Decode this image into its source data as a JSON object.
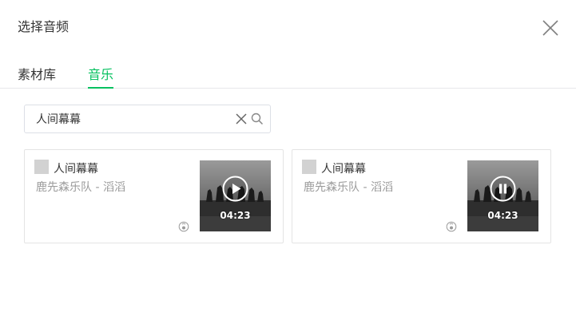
{
  "dialog": {
    "title": "选择音频",
    "close_icon": "close-icon"
  },
  "tabs": [
    {
      "label": "素材库",
      "active": false
    },
    {
      "label": "音乐",
      "active": true
    }
  ],
  "search": {
    "value": "人间幕幕",
    "placeholder": "",
    "clear_icon": "clear-icon",
    "search_icon": "search-icon"
  },
  "results": [
    {
      "title": "人间幕幕",
      "artist": "鹿先森乐队 - 滔滔",
      "duration": "04:23",
      "state": "paused",
      "control_icon": "play-icon"
    },
    {
      "title": "人间幕幕",
      "artist": "鹿先森乐队 - 滔滔",
      "duration": "04:23",
      "state": "playing",
      "control_icon": "pause-icon"
    }
  ],
  "colors": {
    "accent": "#07c160",
    "text": "#353535",
    "muted": "#9a9a9a",
    "border": "#e4e4e4"
  }
}
